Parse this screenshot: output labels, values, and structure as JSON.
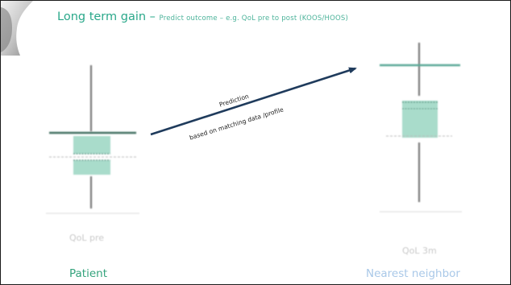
{
  "slide": {
    "title_main": "Long term gain – ",
    "title_sub": "Predict outcome – e.g. QoL pre to post (KOOS/HOOS)"
  },
  "arrow": {
    "label_top": "Prediction",
    "label_bottom": "based on matching data /profile",
    "color": "#1f3b5c"
  },
  "plots": {
    "patient": {
      "axis_label": "QoL pre",
      "caption": "Patient",
      "caption_color": "#34a37c"
    },
    "neighbor": {
      "axis_label": "QoL 3m",
      "caption": "Nearest neighbor",
      "caption_color": "#a9c8e8"
    }
  },
  "colors": {
    "box_fill": "#a9dccb",
    "accent": "#2aa88a"
  }
}
